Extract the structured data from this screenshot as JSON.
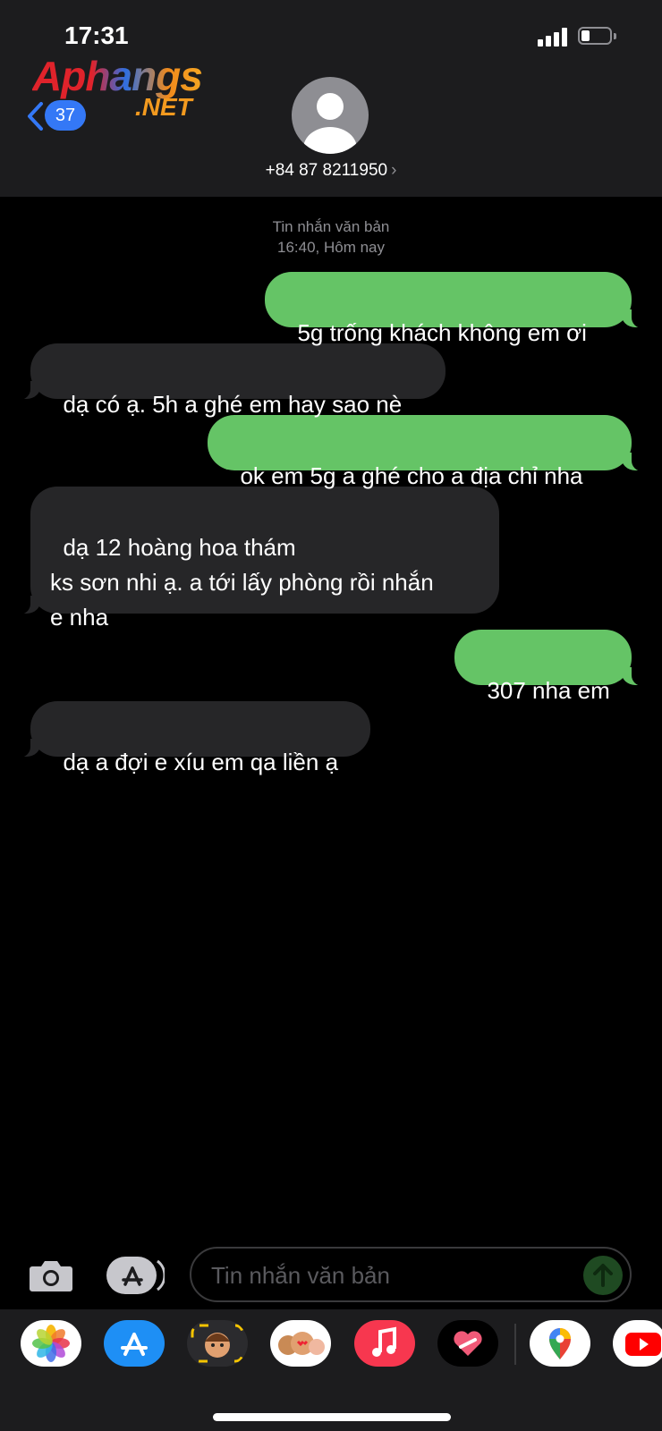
{
  "status": {
    "time": "17:31"
  },
  "watermark": {
    "brand": "Aphangs",
    "tld": ".NET"
  },
  "nav": {
    "back_badge": "37"
  },
  "contact": {
    "number": "+84 87 8211950",
    "chevron": "›"
  },
  "thread": {
    "type": "Tin nhắn văn bản",
    "date": "16:40, Hôm nay"
  },
  "messages": [
    {
      "direction": "outgoing",
      "text": "5g trống khách không em ơi"
    },
    {
      "direction": "incoming",
      "text": "dạ có ạ. 5h a ghé em hay sao nè"
    },
    {
      "direction": "outgoing",
      "text": "ok em 5g a ghé cho a địa chỉ nha"
    },
    {
      "direction": "incoming",
      "text": "dạ 12 hoàng hoa thám\nks sơn nhi ạ. a tới lấy phòng rồi nhắn\ne nha"
    },
    {
      "direction": "outgoing",
      "text": "307 nha em"
    },
    {
      "direction": "incoming",
      "text": "dạ a đợi e xíu em qa liền ạ"
    }
  ],
  "composer": {
    "placeholder": "Tin nhắn văn bản"
  },
  "icons": {
    "camera": "camera-icon",
    "app_store": "app-store-icon",
    "send": "send-arrow-icon",
    "dock": [
      "photos-icon",
      "app-store-icon",
      "memoji-icon",
      "memoji-stickers-icon",
      "music-icon",
      "fitness-heart-icon",
      "google-maps-icon",
      "youtube-icon"
    ]
  },
  "colors": {
    "outgoing_bubble": "#65c466",
    "incoming_bubble": "#262628",
    "header_bg": "#1c1c1e",
    "badge": "#3478f6"
  }
}
